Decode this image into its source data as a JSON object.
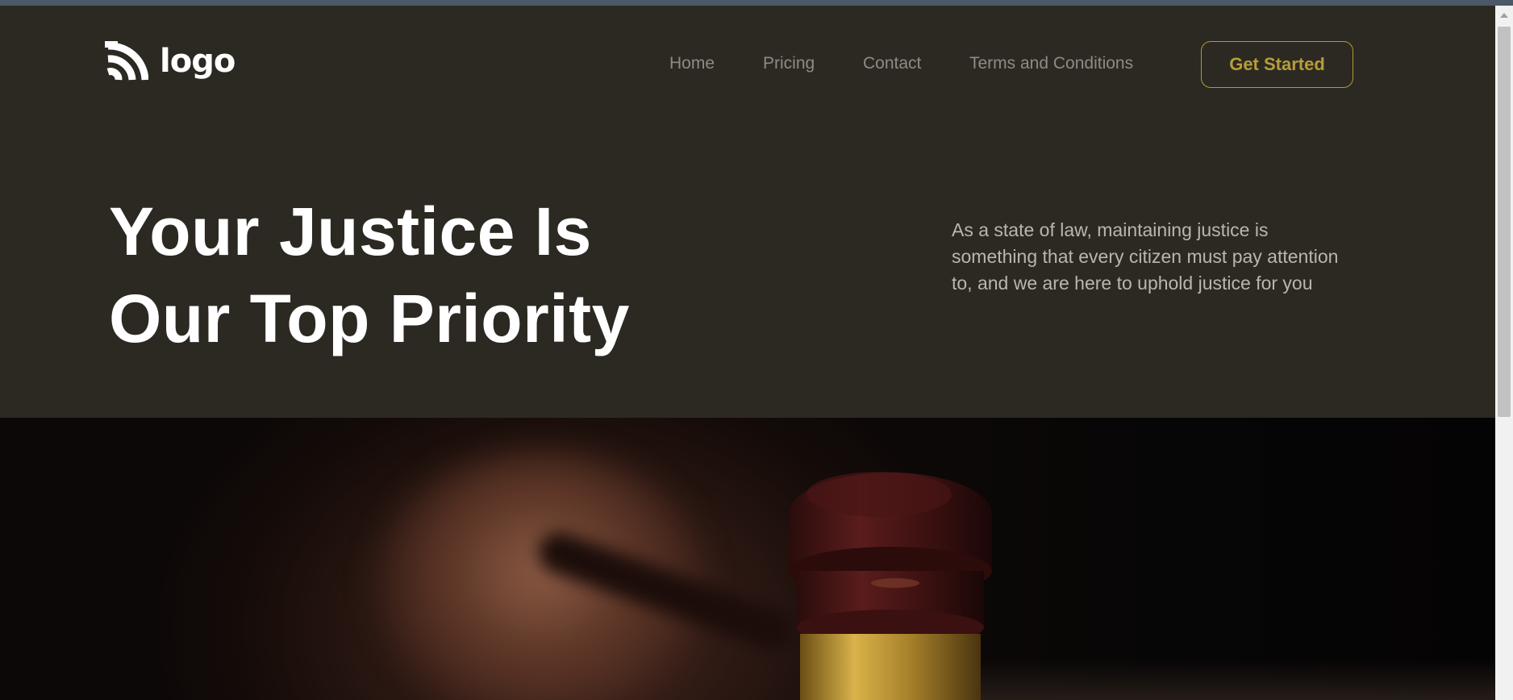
{
  "brand": {
    "logo_text": "logo",
    "logo_icon": "rss-arcs-icon"
  },
  "nav": {
    "items": [
      {
        "label": "Home"
      },
      {
        "label": "Pricing"
      },
      {
        "label": "Contact"
      },
      {
        "label": "Terms and Conditions"
      }
    ],
    "cta_label": "Get Started"
  },
  "hero": {
    "title_line1": "Your Justice Is",
    "title_line2": "Our Top Priority",
    "description": "As a state of law, maintaining justice is something that every citizen must pay attention to, and we are here to uphold justice for you"
  },
  "colors": {
    "background": "#2c2922",
    "accent": "#b69d3a",
    "nav_text": "#8d8b85",
    "heading": "#ffffff"
  },
  "image": {
    "subject": "gavel-photo"
  }
}
